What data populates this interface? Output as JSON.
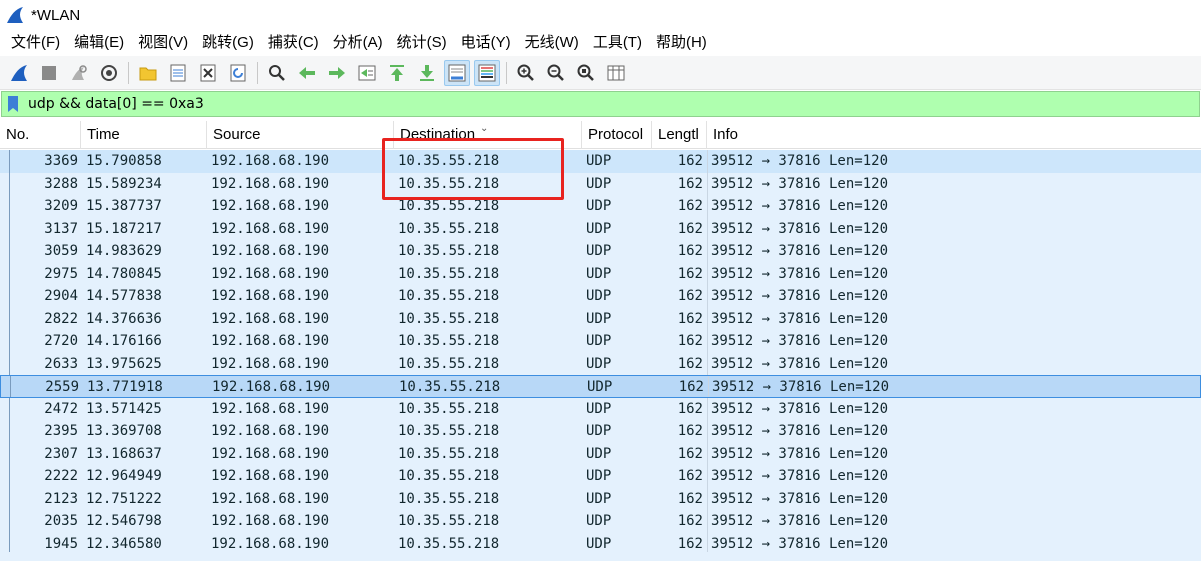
{
  "window": {
    "title": "*WLAN"
  },
  "menu": [
    "文件(F)",
    "编辑(E)",
    "视图(V)",
    "跳转(G)",
    "捕获(C)",
    "分析(A)",
    "统计(S)",
    "电话(Y)",
    "无线(W)",
    "工具(T)",
    "帮助(H)"
  ],
  "toolbar": {
    "icons": [
      "start-capture-icon",
      "stop-capture-icon",
      "restart-capture-icon",
      "capture-options-icon",
      "open-file-icon",
      "save-file-icon",
      "close-file-icon",
      "reload-file-icon",
      "find-packet-icon",
      "go-back-icon",
      "go-forward-icon",
      "go-to-packet-icon",
      "first-packet-icon",
      "last-packet-icon",
      "autoscroll-icon",
      "colorize-icon",
      "zoom-in-icon",
      "zoom-out-icon",
      "normal-size-icon",
      "resize-columns-icon"
    ],
    "accent": "#3d7fd6"
  },
  "filter": {
    "value": "udp && data[0] == 0xa3",
    "bg_color": "#afffaf"
  },
  "columns": [
    "No.",
    "Time",
    "Source",
    "Destination",
    "Protocol",
    "Length",
    "Info"
  ],
  "columns_display": [
    "No.",
    "Time",
    "Source",
    "Destination",
    "Protocol",
    "Lengtl",
    "Info"
  ],
  "sort": {
    "column": "Destination",
    "indicator": "chevron-down-icon"
  },
  "packets": [
    {
      "no": "3369",
      "time": "15.790858",
      "src": "192.168.68.190",
      "dst": "10.35.55.218",
      "proto": "UDP",
      "len": "162",
      "info": "39512 → 37816 Len=120"
    },
    {
      "no": "3288",
      "time": "15.589234",
      "src": "192.168.68.190",
      "dst": "10.35.55.218",
      "proto": "UDP",
      "len": "162",
      "info": "39512 → 37816 Len=120"
    },
    {
      "no": "3209",
      "time": "15.387737",
      "src": "192.168.68.190",
      "dst": "10.35.55.218",
      "proto": "UDP",
      "len": "162",
      "info": "39512 → 37816 Len=120"
    },
    {
      "no": "3137",
      "time": "15.187217",
      "src": "192.168.68.190",
      "dst": "10.35.55.218",
      "proto": "UDP",
      "len": "162",
      "info": "39512 → 37816 Len=120"
    },
    {
      "no": "3059",
      "time": "14.983629",
      "src": "192.168.68.190",
      "dst": "10.35.55.218",
      "proto": "UDP",
      "len": "162",
      "info": "39512 → 37816 Len=120"
    },
    {
      "no": "2975",
      "time": "14.780845",
      "src": "192.168.68.190",
      "dst": "10.35.55.218",
      "proto": "UDP",
      "len": "162",
      "info": "39512 → 37816 Len=120"
    },
    {
      "no": "2904",
      "time": "14.577838",
      "src": "192.168.68.190",
      "dst": "10.35.55.218",
      "proto": "UDP",
      "len": "162",
      "info": "39512 → 37816 Len=120"
    },
    {
      "no": "2822",
      "time": "14.376636",
      "src": "192.168.68.190",
      "dst": "10.35.55.218",
      "proto": "UDP",
      "len": "162",
      "info": "39512 → 37816 Len=120"
    },
    {
      "no": "2720",
      "time": "14.176166",
      "src": "192.168.68.190",
      "dst": "10.35.55.218",
      "proto": "UDP",
      "len": "162",
      "info": "39512 → 37816 Len=120"
    },
    {
      "no": "2633",
      "time": "13.975625",
      "src": "192.168.68.190",
      "dst": "10.35.55.218",
      "proto": "UDP",
      "len": "162",
      "info": "39512 → 37816 Len=120"
    },
    {
      "no": "2559",
      "time": "13.771918",
      "src": "192.168.68.190",
      "dst": "10.35.55.218",
      "proto": "UDP",
      "len": "162",
      "info": "39512 → 37816 Len=120"
    },
    {
      "no": "2472",
      "time": "13.571425",
      "src": "192.168.68.190",
      "dst": "10.35.55.218",
      "proto": "UDP",
      "len": "162",
      "info": "39512 → 37816 Len=120"
    },
    {
      "no": "2395",
      "time": "13.369708",
      "src": "192.168.68.190",
      "dst": "10.35.55.218",
      "proto": "UDP",
      "len": "162",
      "info": "39512 → 37816 Len=120"
    },
    {
      "no": "2307",
      "time": "13.168637",
      "src": "192.168.68.190",
      "dst": "10.35.55.218",
      "proto": "UDP",
      "len": "162",
      "info": "39512 → 37816 Len=120"
    },
    {
      "no": "2222",
      "time": "12.964949",
      "src": "192.168.68.190",
      "dst": "10.35.55.218",
      "proto": "UDP",
      "len": "162",
      "info": "39512 → 37816 Len=120"
    },
    {
      "no": "2123",
      "time": "12.751222",
      "src": "192.168.68.190",
      "dst": "10.35.55.218",
      "proto": "UDP",
      "len": "162",
      "info": "39512 → 37816 Len=120"
    },
    {
      "no": "2035",
      "time": "12.546798",
      "src": "192.168.68.190",
      "dst": "10.35.55.218",
      "proto": "UDP",
      "len": "162",
      "info": "39512 → 37816 Len=120"
    },
    {
      "no": "1945",
      "time": "12.346580",
      "src": "192.168.68.190",
      "dst": "10.35.55.218",
      "proto": "UDP",
      "len": "162",
      "info": "39512 → 37816 Len=120"
    }
  ],
  "selected_no": "2559",
  "annotation": {
    "color": "#e8231f"
  }
}
